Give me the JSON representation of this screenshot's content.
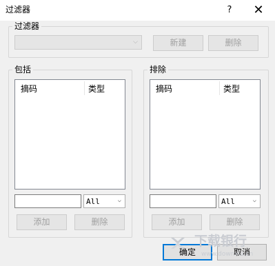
{
  "window": {
    "title": "过滤器",
    "help": "?",
    "close": "✕"
  },
  "filter_group": {
    "legend": "过滤器",
    "select_value": "",
    "new_label": "新建",
    "delete_label": "删除"
  },
  "include": {
    "legend": "包括",
    "columns": [
      "摘码",
      "类型"
    ],
    "input_value": "",
    "type_value": "All",
    "add_label": "添加",
    "delete_label": "删除"
  },
  "exclude": {
    "legend": "排除",
    "columns": [
      "摘码",
      "类型"
    ],
    "input_value": "",
    "type_value": "All",
    "add_label": "添加",
    "delete_label": "删除"
  },
  "footer": {
    "ok_label": "确定",
    "cancel_label": "取消"
  },
  "watermark": {
    "text": "下载银行",
    "url": "www.downxia.cn"
  }
}
